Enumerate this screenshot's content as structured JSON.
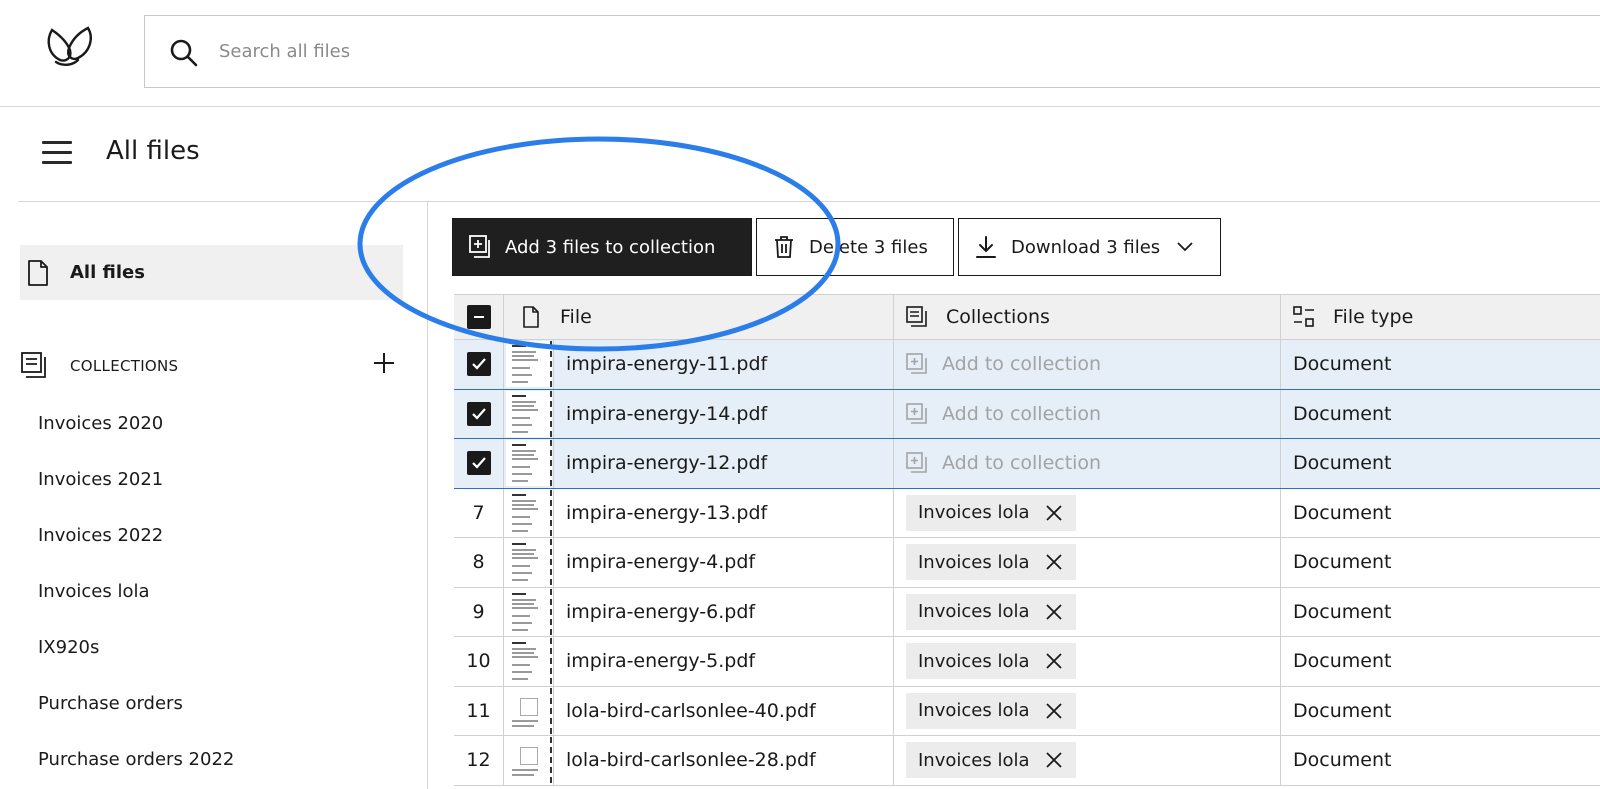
{
  "search": {
    "placeholder": "Search all files"
  },
  "page": {
    "title": "All files"
  },
  "sidebar": {
    "all_files_label": "All files",
    "collections_heading": "COLLECTIONS",
    "collections": [
      "Invoices 2020",
      "Invoices 2021",
      "Invoices 2022",
      "Invoices lola",
      "IX920s",
      "Purchase orders",
      "Purchase orders 2022"
    ]
  },
  "toolbar": {
    "add_label": "Add 3 files to collection",
    "delete_label": "Delete 3 files",
    "download_label": "Download 3 files"
  },
  "table": {
    "headers": {
      "file": "File",
      "collections": "Collections",
      "file_type": "File type"
    },
    "rows": [
      {
        "index": "",
        "selected": true,
        "file": "impira-energy-11.pdf",
        "collection": "Add to collection",
        "type": "Document"
      },
      {
        "index": "",
        "selected": true,
        "file": "impira-energy-14.pdf",
        "collection": "Add to collection",
        "type": "Document"
      },
      {
        "index": "",
        "selected": true,
        "file": "impira-energy-12.pdf",
        "collection": "Add to collection",
        "type": "Document"
      },
      {
        "index": "7",
        "selected": false,
        "file": "impira-energy-13.pdf",
        "collection": "Invoices lola",
        "type": "Document"
      },
      {
        "index": "8",
        "selected": false,
        "file": "impira-energy-4.pdf",
        "collection": "Invoices lola",
        "type": "Document"
      },
      {
        "index": "9",
        "selected": false,
        "file": "impira-energy-6.pdf",
        "collection": "Invoices lola",
        "type": "Document"
      },
      {
        "index": "10",
        "selected": false,
        "file": "impira-energy-5.pdf",
        "collection": "Invoices lola",
        "type": "Document"
      },
      {
        "index": "11",
        "selected": false,
        "file": "lola-bird-carlsonlee-40.pdf",
        "collection": "Invoices lola",
        "type": "Document"
      },
      {
        "index": "12",
        "selected": false,
        "file": "lola-bird-carlsonlee-28.pdf",
        "collection": "Invoices lola",
        "type": "Document"
      }
    ]
  },
  "colors": {
    "annotation": "#2b7de9",
    "selected_row": "#e6eef8",
    "primary_button": "#1f1f1f"
  }
}
